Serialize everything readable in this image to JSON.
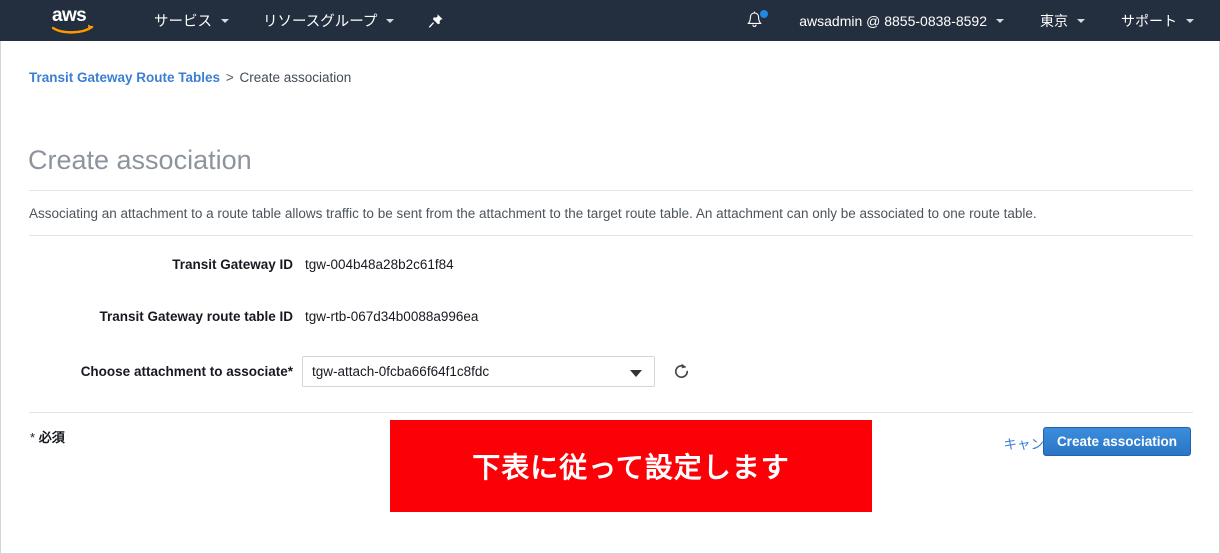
{
  "navbar": {
    "logo_text": "aws",
    "logo_icon": "aws-logo",
    "services_label": "サービス",
    "resource_groups_label": "リソースグループ",
    "pin_icon": "pushpin-icon",
    "bell_icon": "bell-notification-icon",
    "account_label": "awsadmin @ 8855-0838-8592",
    "region_label": "東京",
    "support_label": "サポート",
    "background_color": "#232f3e"
  },
  "breadcrumb": {
    "parent": "Transit Gateway Route Tables",
    "separator": ">",
    "current": "Create association"
  },
  "page": {
    "title": "Create association",
    "description": "Associating an attachment to a route table allows traffic to be sent from the attachment to the target route table. An attachment can only be associated to one route table."
  },
  "form": {
    "transit_gateway_id": {
      "label": "Transit Gateway ID",
      "value": "tgw-004b48a28b2c61f84"
    },
    "transit_gateway_route_table_id": {
      "label": "Transit Gateway route table ID",
      "value": "tgw-rtb-067d34b0088a996ea"
    },
    "attachment": {
      "label": "Choose attachment to associate*",
      "selected_value": "tgw-attach-0fcba66f64f1c8fdc",
      "dropdown_icon": "chevron-down-icon",
      "refresh_icon": "refresh-icon"
    }
  },
  "footer": {
    "required_star": "*",
    "required_label": "必須",
    "cancel_label": "キャンセル",
    "submit_label": "Create association",
    "submit_color": "#2a75c6"
  },
  "annotation": {
    "text": "下表に従って設定します",
    "background_color": "#fb0006",
    "text_color": "#ffffff"
  }
}
